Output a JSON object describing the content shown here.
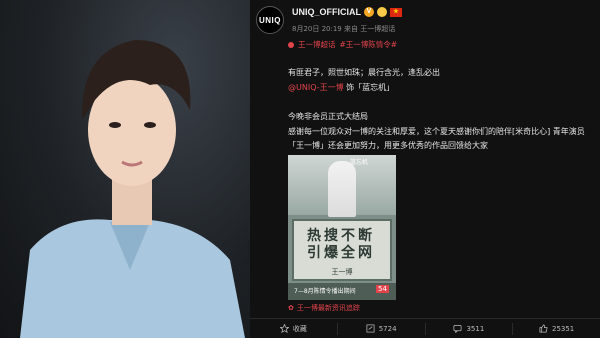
{
  "post": {
    "avatar_text": "UNIQ",
    "username": "UNIQ_OFFICIAL",
    "meta": "8月20日 20:19 来自 王一博超话",
    "tags": [
      "王一博超话",
      "#王一博陈情令#"
    ],
    "lines": [
      "有匪君子，照世如珠；晨行含光，逢乱必出",
      "@UNIQ-王一博 饰「蓝忘机」",
      "今晚非会员正式大结局",
      "感谢每一位观众对一博的关注和厚爱，这个夏天感谢你们的陪伴[米奇比心] 青年演员「王一博」还会更加努力，用更多优秀的作品回馈给大家"
    ],
    "mention": "@UNIQ-王一博",
    "mention_rest": " 饰「蓝忘机」",
    "embed": {
      "figure_name": "蓝忘机",
      "headline_1": "热搜不断",
      "headline_2": "引爆全网",
      "name": "王一博",
      "date": "7—8月陈情令播出期间",
      "ribbon": "54"
    },
    "source": "王一博最新资讯追踪"
  },
  "actions": {
    "favorite": "收藏",
    "repost": "5724",
    "comment": "3511",
    "like": "25351"
  },
  "colors": {
    "accent": "#e1444b",
    "bg": "#111111"
  }
}
